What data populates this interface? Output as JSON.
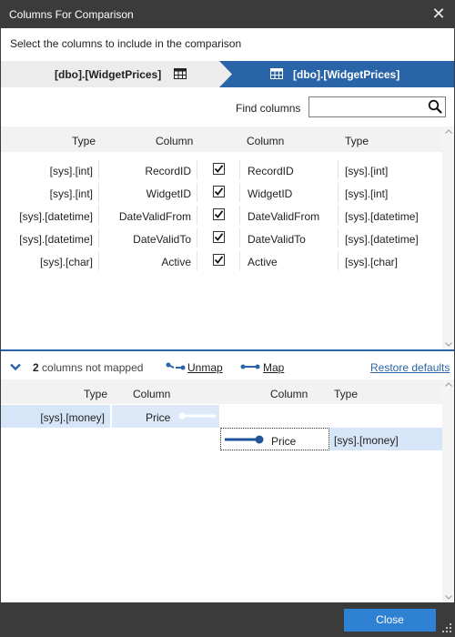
{
  "window": {
    "title": "Columns For Comparison",
    "close_glyph": "✕"
  },
  "instruction": "Select the columns to include in the comparison",
  "breadcrumb": {
    "left_label": "[dbo].[WidgetPrices]",
    "left_icon": "table-icon",
    "right_label": "[dbo].[WidgetPrices]",
    "right_icon": "table-icon",
    "active_color": "#2a64a8"
  },
  "find": {
    "label": "Find columns",
    "value": "",
    "placeholder": "",
    "icon": "search-icon"
  },
  "upper_grid": {
    "headers": {
      "left_type": "Type",
      "left_column": "Column",
      "right_column": "Column",
      "right_type": "Type"
    },
    "rows": [
      {
        "left_type": "[sys].[int]",
        "left_column": "RecordID",
        "checked": true,
        "right_column": "RecordID",
        "right_type": "[sys].[int]"
      },
      {
        "left_type": "[sys].[int]",
        "left_column": "WidgetID",
        "checked": true,
        "right_column": "WidgetID",
        "right_type": "[sys].[int]"
      },
      {
        "left_type": "[sys].[datetime]",
        "left_column": "DateValidFrom",
        "checked": true,
        "right_column": "DateValidFrom",
        "right_type": "[sys].[datetime]"
      },
      {
        "left_type": "[sys].[datetime]",
        "left_column": "DateValidTo",
        "checked": true,
        "right_column": "DateValidTo",
        "right_type": "[sys].[datetime]"
      },
      {
        "left_type": "[sys].[char]",
        "left_column": "Active",
        "checked": true,
        "right_column": "Active",
        "right_type": "[sys].[char]"
      }
    ]
  },
  "map_toolbar": {
    "unmapped_count": "2",
    "unmapped_text": " columns not mapped",
    "unmap_label": "Unmap",
    "map_label": "Map",
    "restore_label": "Restore defaults"
  },
  "lower_grid": {
    "headers": {
      "left_type": "Type",
      "left_column": "Column",
      "right_column": "Column",
      "right_type": "Type"
    },
    "left_row": {
      "type": "[sys].[money]",
      "column": "Price"
    },
    "right_row": {
      "column": "Price",
      "type": "[sys].[money]"
    }
  },
  "footer": {
    "close_label": "Close",
    "button_color": "#2f82d3"
  }
}
